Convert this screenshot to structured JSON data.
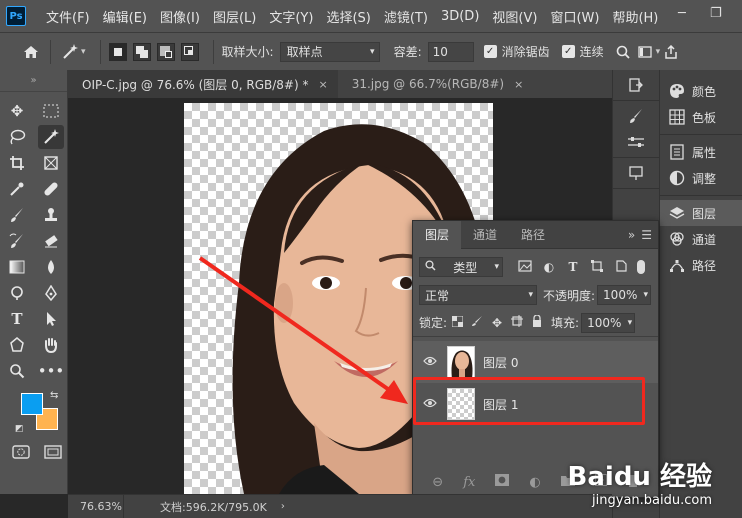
{
  "app": {
    "logo": "Ps"
  },
  "menu": [
    "文件(F)",
    "编辑(E)",
    "图像(I)",
    "图层(L)",
    "文字(Y)",
    "选择(S)",
    "滤镜(T)",
    "3D(D)",
    "视图(V)",
    "窗口(W)",
    "帮助(H)"
  ],
  "window_controls": {
    "minimize": "─",
    "restore": "❐"
  },
  "options": {
    "sample_size_label": "取样大小:",
    "sample_size_value": "取样点",
    "tolerance_label": "容差:",
    "tolerance_value": "10",
    "antialias_label": "消除锯齿",
    "contiguous_label": "连续"
  },
  "tabs": [
    {
      "label": "OIP-C.jpg @ 76.6% (图层 0, RGB/8#) *",
      "close": "×"
    },
    {
      "label": "31.jpg @ 66.7%(RGB/8#)",
      "close": "×"
    }
  ],
  "right_panel": {
    "group1": [
      "颜色",
      "色板"
    ],
    "group2": [
      "属性",
      "调整"
    ],
    "group3": [
      "图层",
      "通道",
      "路径"
    ]
  },
  "layers_panel": {
    "tabs": [
      "图层",
      "通道",
      "路径"
    ],
    "filter_type": "类型",
    "blend_mode": "正常",
    "opacity_label": "不透明度:",
    "opacity_value": "100%",
    "lock_label": "锁定:",
    "fill_label": "填充:",
    "fill_value": "100%",
    "layers": [
      {
        "name": "图层 0"
      },
      {
        "name": "图层 1"
      }
    ]
  },
  "status": {
    "zoom": "76.63%",
    "doc": "文档:596.2K/795.0K"
  },
  "watermark": {
    "logo": "Baidu 经验",
    "url": "jingyan.baidu.com"
  },
  "colors": {
    "foreground": "#0a9ef1",
    "background": "#ffb34f",
    "highlight": "#f0281e"
  }
}
